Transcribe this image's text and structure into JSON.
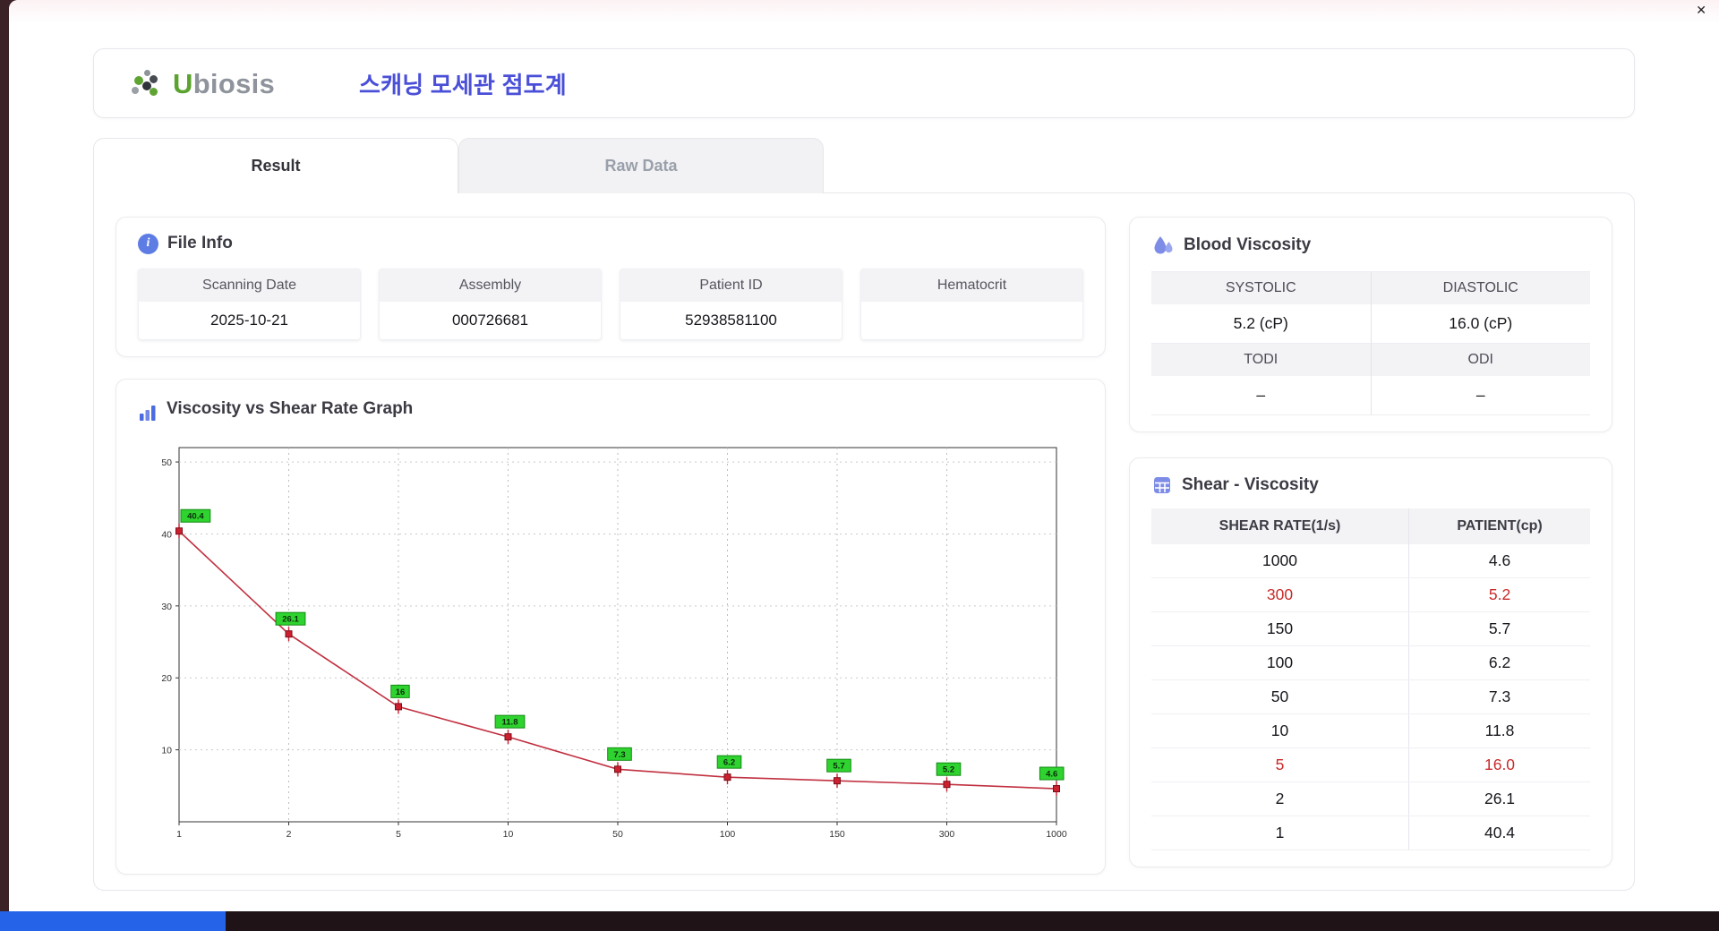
{
  "window": {
    "close_label": "✕"
  },
  "icons": {
    "info": "i"
  },
  "header": {
    "brand_u": "U",
    "brand_rest": "biosis",
    "title": "스캐닝 모세관 점도계"
  },
  "tabs": {
    "result": "Result",
    "raw_data": "Raw Data"
  },
  "file_info": {
    "title": "File Info",
    "fields": [
      {
        "label": "Scanning Date",
        "value": "2025-10-21"
      },
      {
        "label": "Assembly",
        "value": "000726681"
      },
      {
        "label": "Patient ID",
        "value": "52938581100"
      },
      {
        "label": "Hematocrit",
        "value": ""
      }
    ]
  },
  "blood_viscosity": {
    "title": "Blood Viscosity",
    "cells": [
      {
        "label": "SYSTOLIC",
        "value": "5.2 (cP)"
      },
      {
        "label": "DIASTOLIC",
        "value": "16.0 (cP)"
      },
      {
        "label": "TODI",
        "value": "–"
      },
      {
        "label": "ODI",
        "value": "–"
      }
    ]
  },
  "graph": {
    "title": "Viscosity vs Shear Rate Graph"
  },
  "chart_data": {
    "type": "line",
    "title": "Viscosity vs Shear Rate Graph",
    "xlabel": "",
    "ylabel": "",
    "categories": [
      "1",
      "2",
      "5",
      "10",
      "50",
      "100",
      "150",
      "300",
      "1000"
    ],
    "values": [
      40.4,
      26.1,
      16,
      11.8,
      7.3,
      6.2,
      5.7,
      5.2,
      4.6
    ],
    "point_labels": [
      "40.4",
      "26.1",
      "16",
      "11.8",
      "7.3",
      "6.2",
      "5.7",
      "5.2",
      "4.6"
    ],
    "ylim": [
      0,
      52
    ],
    "yticks": [
      10,
      20,
      30,
      40,
      50
    ],
    "grid": true,
    "line_color": "#c13040",
    "marker_color": "#cc2030",
    "point_label_bg": "#2fd32f",
    "point_label_border": "#128a12"
  },
  "shear_table": {
    "title": "Shear - Viscosity",
    "columns": [
      "SHEAR RATE(1/s)",
      "PATIENT(cp)"
    ],
    "rows": [
      {
        "rate": "1000",
        "value": "4.6",
        "red": false
      },
      {
        "rate": "300",
        "value": "5.2",
        "red": true
      },
      {
        "rate": "150",
        "value": "5.7",
        "red": false
      },
      {
        "rate": "100",
        "value": "6.2",
        "red": false
      },
      {
        "rate": "50",
        "value": "7.3",
        "red": false
      },
      {
        "rate": "10",
        "value": "11.8",
        "red": false
      },
      {
        "rate": "5",
        "value": "16.0",
        "red": true
      },
      {
        "rate": "2",
        "value": "26.1",
        "red": false
      },
      {
        "rate": "1",
        "value": "40.4",
        "red": false
      }
    ]
  },
  "colors": {
    "accent": "#4a4fd8",
    "red": "#c92a2a",
    "green": "#2fd32f"
  }
}
